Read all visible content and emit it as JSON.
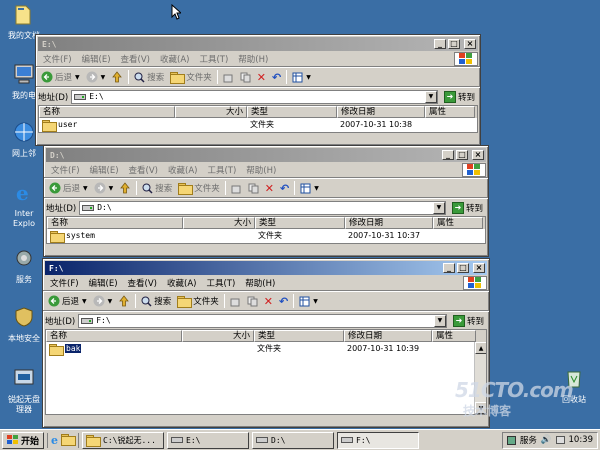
{
  "desktop": {
    "icons": [
      {
        "label": "我的文档"
      },
      {
        "label": "我的电"
      },
      {
        "label": "网上邻"
      },
      {
        "label": "Inter\nExplo"
      },
      {
        "label": "服务"
      },
      {
        "label": "本地安全"
      },
      {
        "label": "锐起无盘\n理器"
      }
    ],
    "recycle": {
      "label": "回收站"
    }
  },
  "windows": [
    {
      "title": "E:\\",
      "menu": [
        "文件(F)",
        "编辑(E)",
        "查看(V)",
        "收藏(A)",
        "工具(T)",
        "帮助(H)"
      ],
      "toolbar": {
        "back": "后退",
        "search": "搜索",
        "folders": "文件夹"
      },
      "address_label": "地址(D)",
      "address_value": "E:\\",
      "go_label": "转到",
      "columns": [
        "名称",
        "大小",
        "类型",
        "修改日期",
        "属性"
      ],
      "rows": [
        {
          "name": "user",
          "size": "",
          "type": "文件夹",
          "date": "2007-10-31 10:38",
          "attr": ""
        }
      ]
    },
    {
      "title": "D:\\",
      "menu": [
        "文件(F)",
        "编辑(E)",
        "查看(V)",
        "收藏(A)",
        "工具(T)",
        "帮助(H)"
      ],
      "toolbar": {
        "back": "后退",
        "search": "搜索",
        "folders": "文件夹"
      },
      "address_label": "地址(D)",
      "address_value": "D:\\",
      "go_label": "转到",
      "columns": [
        "名称",
        "大小",
        "类型",
        "修改日期",
        "属性"
      ],
      "rows": [
        {
          "name": "system",
          "size": "",
          "type": "文件夹",
          "date": "2007-10-31 10:37",
          "attr": ""
        }
      ]
    },
    {
      "title": "F:\\",
      "menu": [
        "文件(F)",
        "编辑(E)",
        "查看(V)",
        "收藏(A)",
        "工具(T)",
        "帮助(H)"
      ],
      "toolbar": {
        "back": "后退",
        "search": "搜索",
        "folders": "文件夹"
      },
      "address_label": "地址(D)",
      "address_value": "F:\\",
      "go_label": "转到",
      "columns": [
        "名称",
        "大小",
        "类型",
        "修改日期",
        "属性"
      ],
      "rows": [
        {
          "name": "bak",
          "size": "",
          "type": "文件夹",
          "date": "2007-10-31 10:39",
          "attr": ""
        }
      ]
    }
  ],
  "taskbar": {
    "start_label": "开始",
    "tasks": [
      {
        "label": "C:\\锐起无..."
      },
      {
        "label": "E:\\"
      },
      {
        "label": "D:\\"
      },
      {
        "label": "F:\\"
      }
    ],
    "tray_service": "服务",
    "clock": "10:39"
  },
  "watermark": {
    "line1": "51CTO.com",
    "line2": "技术博客"
  }
}
